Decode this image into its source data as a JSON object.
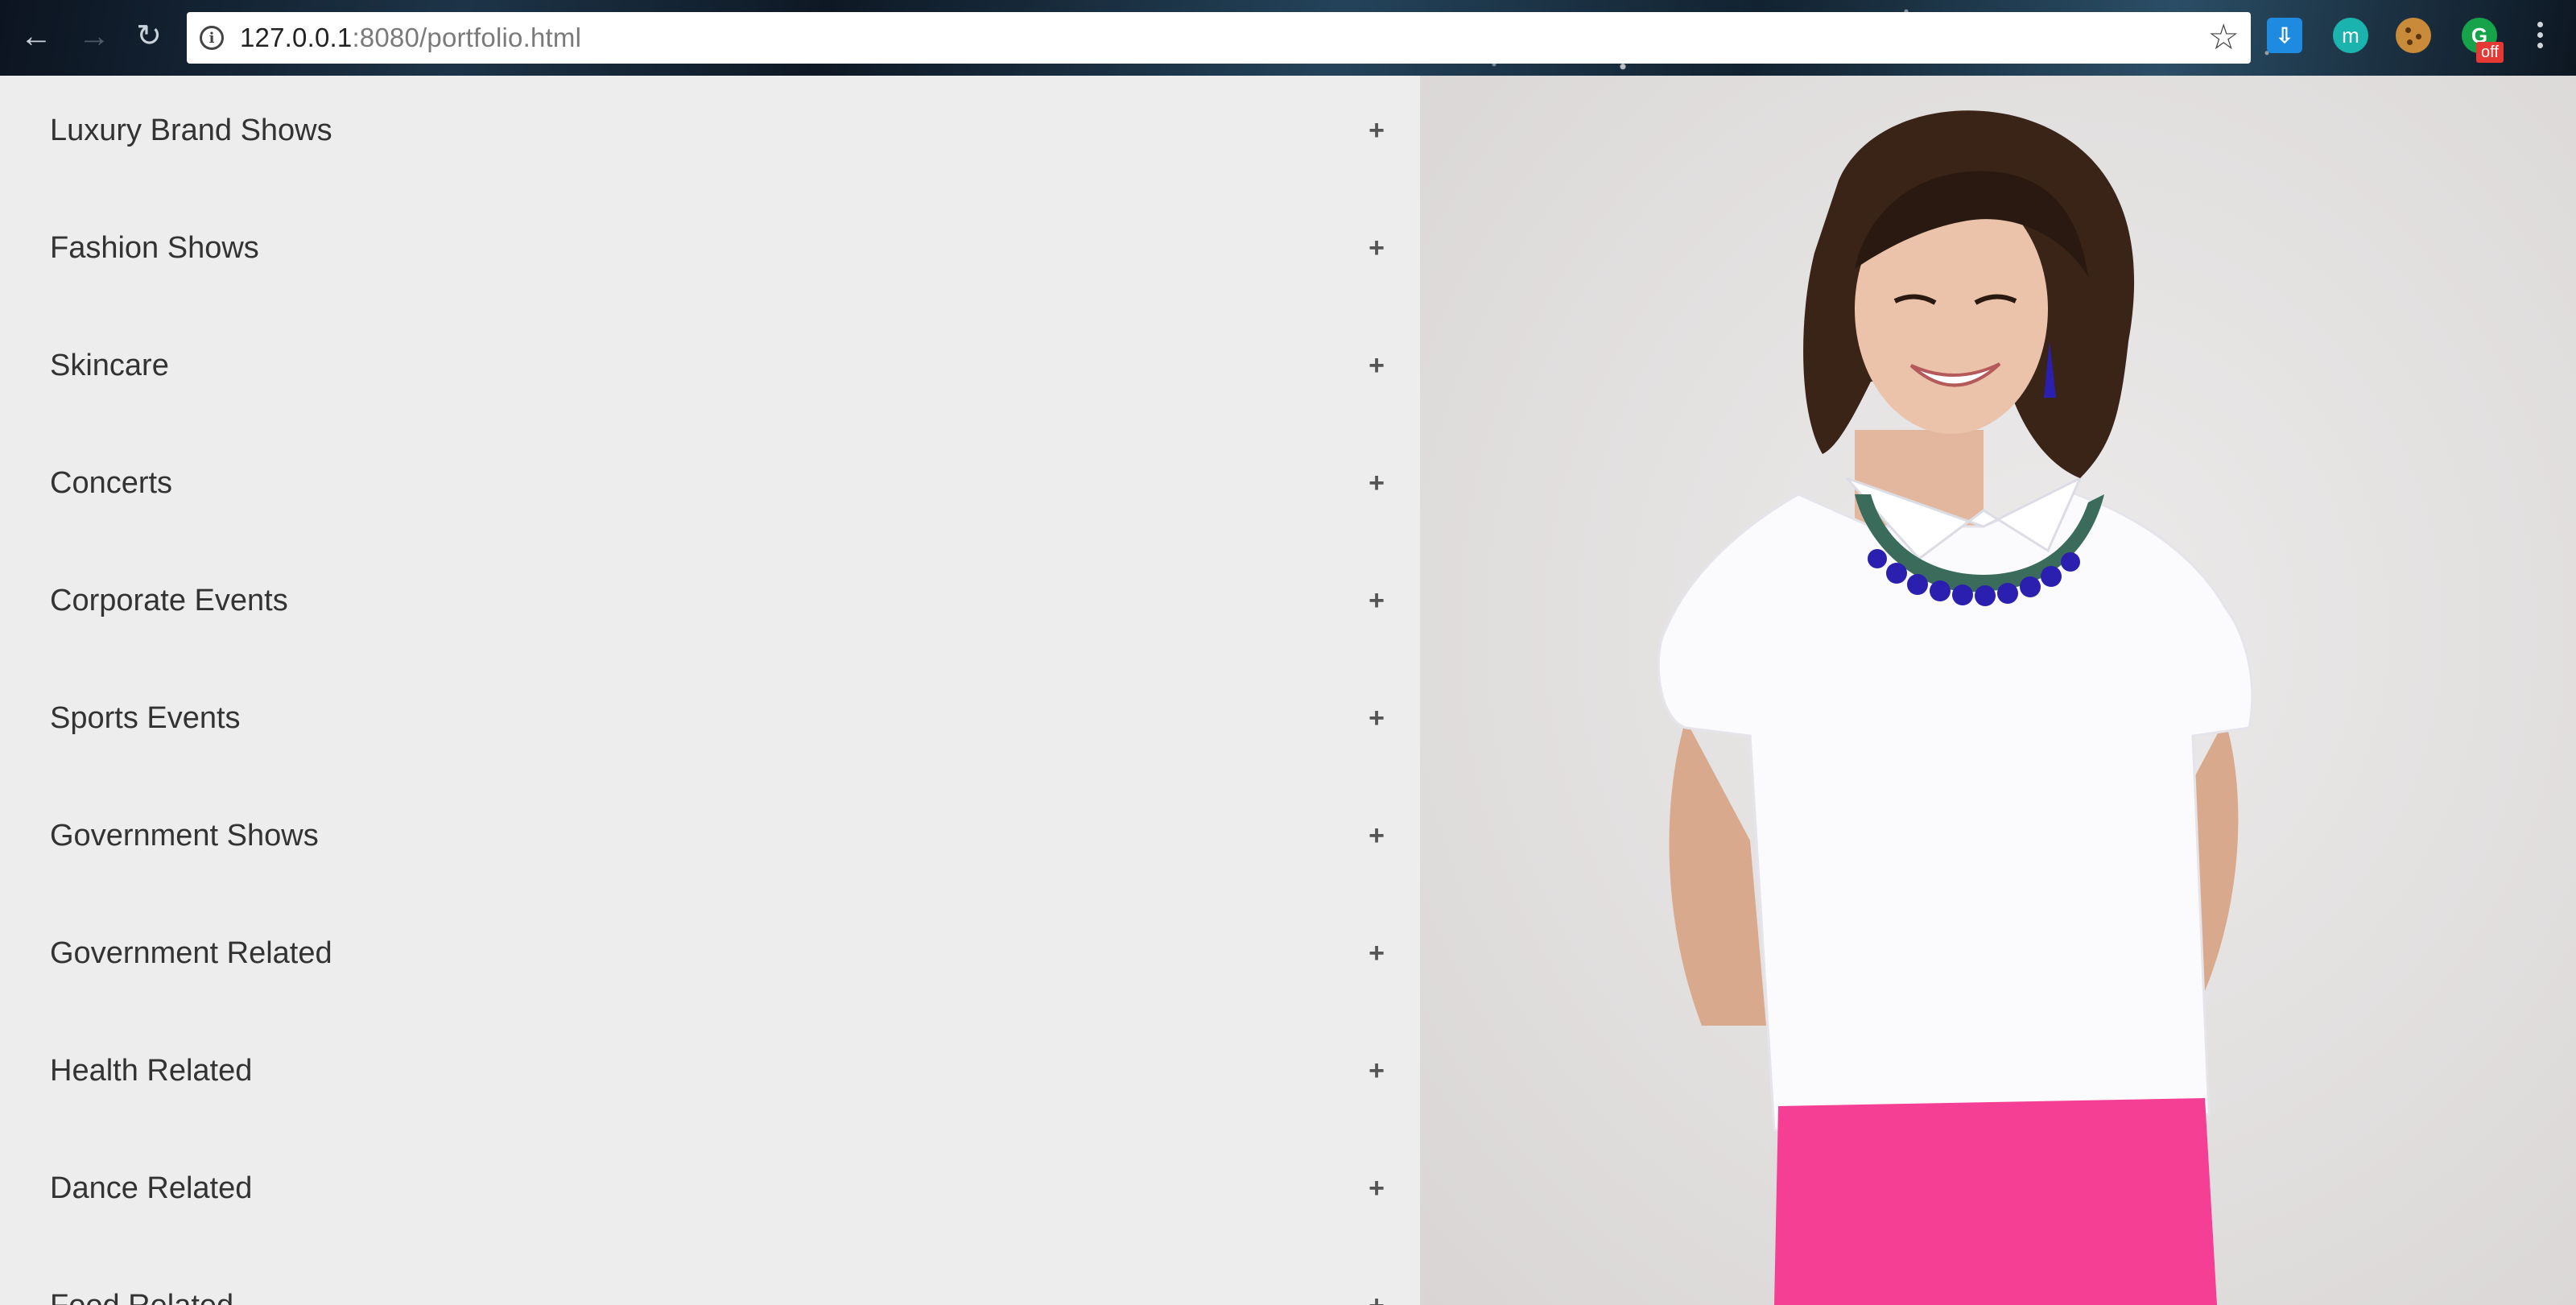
{
  "browser": {
    "url_host": "127.0.0.1",
    "url_rest": ":8080/portfolio.html",
    "extensions": {
      "off_badge": "off",
      "m_label": "m"
    }
  },
  "accordion": {
    "items": [
      {
        "label": "Luxury Brand Shows",
        "toggle": "+"
      },
      {
        "label": "Fashion Shows",
        "toggle": "+"
      },
      {
        "label": "Skincare",
        "toggle": "+"
      },
      {
        "label": "Concerts",
        "toggle": "+"
      },
      {
        "label": "Corporate Events",
        "toggle": "+"
      },
      {
        "label": "Sports Events",
        "toggle": "+"
      },
      {
        "label": "Government Shows",
        "toggle": "+"
      },
      {
        "label": "Government Related",
        "toggle": "+"
      },
      {
        "label": "Health Related",
        "toggle": "+"
      },
      {
        "label": "Dance Related",
        "toggle": "+"
      },
      {
        "label": "Food Related",
        "toggle": "+"
      }
    ]
  },
  "colors": {
    "panel_bg": "#ededed",
    "photo_bg": "#e1dede",
    "blouse": "#ffffff",
    "pants": "#f43f95",
    "hair": "#3a2418",
    "necklace": "#2b1fb0"
  }
}
